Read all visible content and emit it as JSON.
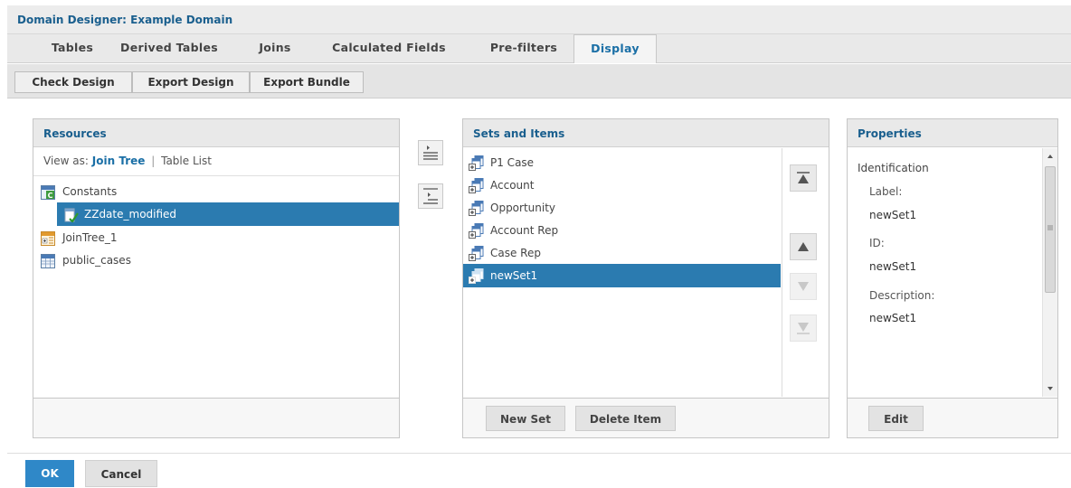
{
  "window": {
    "title": "Domain Designer: Example Domain"
  },
  "tabs": [
    {
      "label": "Tables"
    },
    {
      "label": "Derived Tables"
    },
    {
      "label": "Joins"
    },
    {
      "label": "Calculated Fields"
    },
    {
      "label": "Pre-filters"
    },
    {
      "label": "Display",
      "active": true
    }
  ],
  "toolbar": {
    "check_design": "Check Design",
    "export_design": "Export Design",
    "export_bundle": "Export Bundle"
  },
  "resources": {
    "title": "Resources",
    "view_as_label": "View as:",
    "view_join_tree": "Join Tree",
    "view_separator": "|",
    "view_table_list": "Table List",
    "items": [
      {
        "label": "Constants",
        "icon": "constants-icon"
      },
      {
        "label": "ZZdate_modified",
        "icon": "field-icon",
        "selected": true
      },
      {
        "label": "JoinTree_1",
        "icon": "join-tree-icon"
      },
      {
        "label": "public_cases",
        "icon": "table-icon"
      }
    ]
  },
  "sets": {
    "title": "Sets and Items",
    "items": [
      {
        "label": "P1 Case"
      },
      {
        "label": "Account"
      },
      {
        "label": "Opportunity"
      },
      {
        "label": "Account Rep"
      },
      {
        "label": "Case Rep"
      },
      {
        "label": "newSet1",
        "selected": true
      }
    ],
    "new_set": "New Set",
    "delete_item": "Delete Item"
  },
  "properties": {
    "title": "Properties",
    "section": "Identification",
    "label_label": "Label:",
    "label_value": "newSet1",
    "id_label": "ID:",
    "id_value": "newSet1",
    "desc_label": "Description:",
    "desc_value": "newSet1",
    "edit": "Edit"
  },
  "footer": {
    "ok": "OK",
    "cancel": "Cancel"
  },
  "colors": {
    "accent": "#2b7bb0",
    "title": "#1a5f8e",
    "ok": "#2f88c8"
  }
}
